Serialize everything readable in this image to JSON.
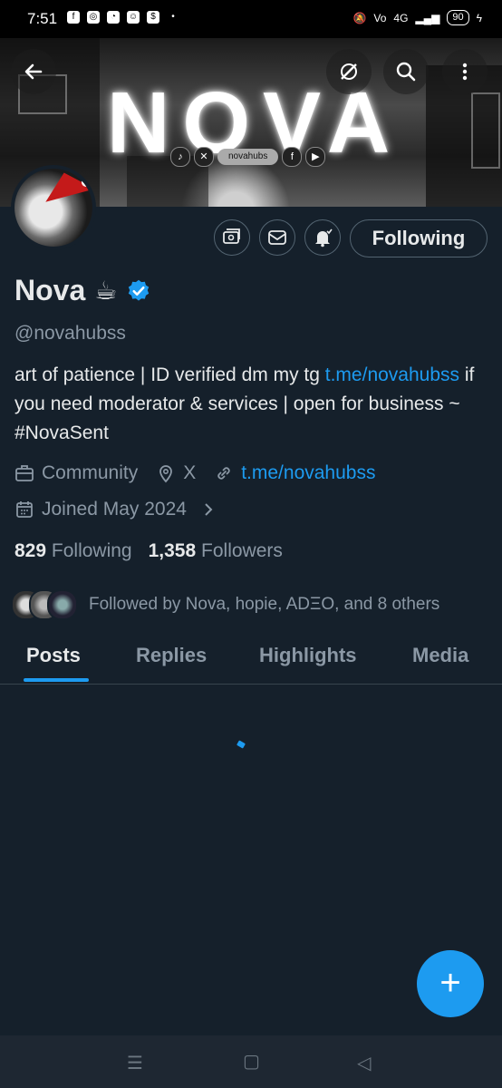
{
  "status_bar": {
    "time": "7:51",
    "battery": "90",
    "network": "4G"
  },
  "banner": {
    "logo_text": "NOVA",
    "social_handle": "novahubs"
  },
  "profile": {
    "display_name": "Nova",
    "name_emoji": "☕",
    "handle": "@novahubss",
    "bio_part1": "art of patience | ID verified dm my tg ",
    "bio_link": "t.me/novahubss",
    "bio_part2": " if you need moderator & services | open for business ~ #NovaSent",
    "category": "Community",
    "location": "X",
    "website": "t.me/novahubss",
    "joined": "Joined May 2024",
    "following_count": "829",
    "following_label": "Following",
    "followers_count": "1,358",
    "followers_label": "Followers",
    "followed_by": "Followed by Nova, hopie, ADΞO, and 8 others"
  },
  "actions": {
    "follow_label": "Following"
  },
  "tabs": [
    "Posts",
    "Replies",
    "Highlights",
    "Media"
  ],
  "fab": {
    "label": "+"
  },
  "colors": {
    "background": "#15202b",
    "accent": "#1d9bf0",
    "muted": "#8b98a5"
  }
}
